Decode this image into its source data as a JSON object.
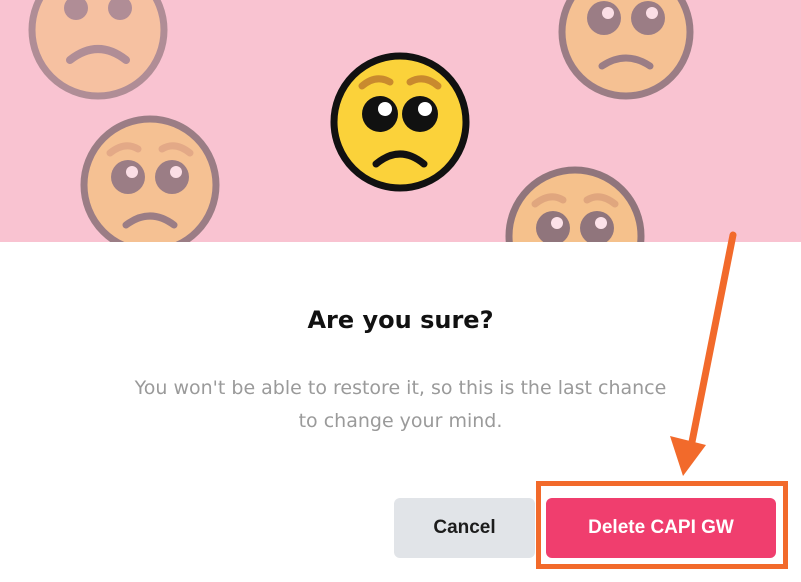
{
  "dialog": {
    "title": "Are you sure?",
    "message_line1": "You won't be able to restore it, so this is the last chance",
    "message_line2": "to change your mind.",
    "cancel_label": "Cancel",
    "delete_label": "Delete CAPI GW"
  },
  "banner": {
    "background": "#f9c3d1",
    "icons": [
      "pleading-face-icon",
      "sad-face-icon"
    ]
  },
  "colors": {
    "delete_button": "#f03e6e",
    "cancel_button": "#e1e4e8",
    "annotation": "#f26a2b"
  }
}
